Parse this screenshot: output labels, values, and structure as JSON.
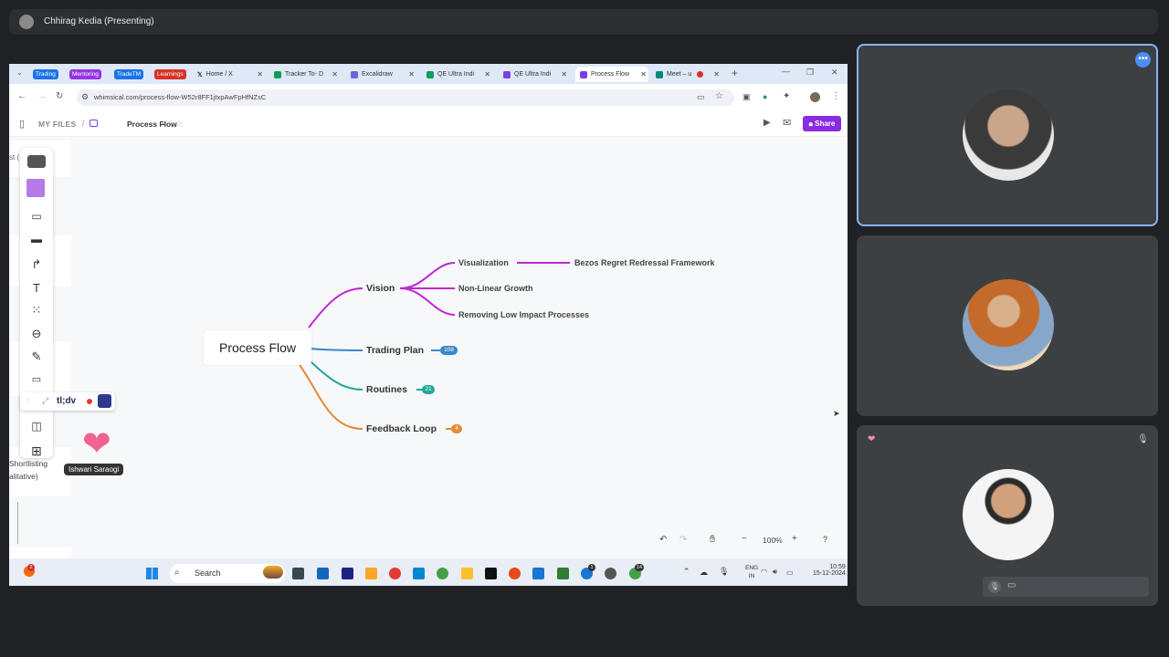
{
  "meet": {
    "presenter_name": "Chhirag Kedia (Presenting)"
  },
  "browser": {
    "bookmark_chips": [
      {
        "label": "Trading",
        "color": "#1a73e8"
      },
      {
        "label": "Mentoring",
        "color": "#9334e6"
      },
      {
        "label": "TradeTM",
        "color": "#1a73e8"
      },
      {
        "label": "Learnings",
        "color": "#d93025"
      }
    ],
    "tabs": [
      {
        "label": "Home / X",
        "icon": "x-logo-icon"
      },
      {
        "label": "Tracker To- D",
        "icon": "sheets-icon"
      },
      {
        "label": "Excalidraw",
        "icon": "excalidraw-icon"
      },
      {
        "label": "QE Ultra Indi",
        "icon": "sheets-icon"
      },
      {
        "label": "QE Ultra Indi",
        "icon": "whimsical-icon"
      },
      {
        "label": "Process Flow",
        "icon": "whimsical-icon",
        "active": true
      },
      {
        "label": "Meet – u",
        "icon": "meet-icon"
      }
    ],
    "url": "whimsical.com/process-flow-W52r8FF1jtxpAwFpHfNZsC"
  },
  "whimsical": {
    "breadcrumb_root": "MY FILES",
    "doc_title": "Process Flow",
    "share_label": "Share",
    "zoom_level": "100%",
    "help_label": "?"
  },
  "mindmap": {
    "root": "Process Flow",
    "branches": [
      {
        "label": "Vision",
        "color": "#c026d3"
      },
      {
        "label": "Trading Plan",
        "color": "#3a86c8",
        "count": "108"
      },
      {
        "label": "Routines",
        "color": "#1fa89a",
        "count": "21"
      },
      {
        "label": "Feedback Loop",
        "color": "#e48a3c",
        "count": "4"
      }
    ],
    "vision_children": [
      {
        "label": "Visualization"
      },
      {
        "label": "Non-Linear Growth"
      },
      {
        "label": "Removing Low Impact Processes"
      }
    ],
    "visualization_child": "Bezos Regret Redressal Framework"
  },
  "background_fragments": {
    "top": "st (          al)",
    "sorting": "Shortlisting",
    "qualitative": "alitative)"
  },
  "tldv": {
    "label": "tl;dv"
  },
  "reaction": {
    "emoji": "❤",
    "name": "Ishwari Saraogi"
  },
  "taskbar": {
    "search_label": "Search",
    "lang_line1": "ENG",
    "lang_line2": "IN",
    "time": "10:59",
    "date": "15-12-2024",
    "chrome_badge": "1",
    "whatsapp_badge": "14",
    "notif_badge": "2"
  }
}
